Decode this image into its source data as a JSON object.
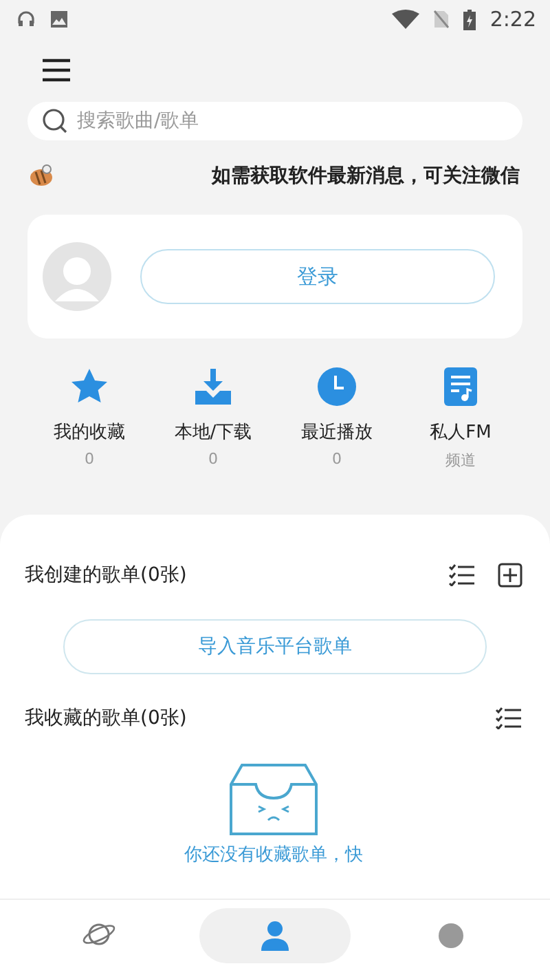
{
  "status_bar": {
    "time": "2:22"
  },
  "search": {
    "placeholder": "搜索歌曲/歌单"
  },
  "notice": {
    "text": "如需获取软件最新消息，可关注微信"
  },
  "user_card": {
    "login_button": "登录"
  },
  "shortcuts": [
    {
      "kind": "star",
      "label": "我的收藏",
      "sub": "0"
    },
    {
      "kind": "download",
      "label": "本地/下载",
      "sub": "0"
    },
    {
      "kind": "clock",
      "label": "最近播放",
      "sub": "0"
    },
    {
      "kind": "note",
      "label": "私人FM",
      "sub": "频道"
    }
  ],
  "created_playlists": {
    "title": "我创建的歌单(0张)",
    "import_button": "导入音乐平台歌单"
  },
  "collected_playlists": {
    "title": "我收藏的歌单(0张)",
    "empty_text": "你还没有收藏歌单，快"
  },
  "bottom_nav": [
    {
      "kind": "planet",
      "selected": false
    },
    {
      "kind": "person",
      "selected": true
    },
    {
      "kind": "circle",
      "selected": false
    }
  ]
}
